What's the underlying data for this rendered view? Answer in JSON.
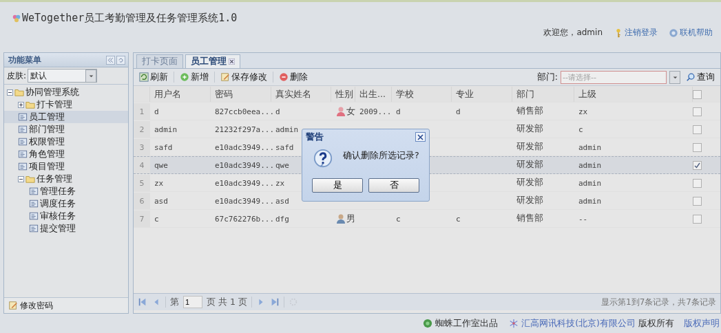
{
  "header": {
    "title": "WeTogether员工考勤管理及任务管理系统1.0",
    "welcome": "欢迎您，admin",
    "links": [
      "注销登录",
      "联机帮助"
    ]
  },
  "sidebar": {
    "title": "功能菜单",
    "skin_label": "皮肤:",
    "skin_value": "默认",
    "tree": [
      {
        "label": "协同管理系统",
        "kind": "folder",
        "expanded": true,
        "selected": false,
        "children": [
          {
            "label": "打卡管理",
            "kind": "folder",
            "expanded": false,
            "selected": false
          },
          {
            "label": "员工管理",
            "kind": "page",
            "selected": true
          },
          {
            "label": "部门管理",
            "kind": "page",
            "selected": false
          },
          {
            "label": "权限管理",
            "kind": "page",
            "selected": false
          },
          {
            "label": "角色管理",
            "kind": "page",
            "selected": false
          },
          {
            "label": "项目管理",
            "kind": "page",
            "selected": false
          },
          {
            "label": "任务管理",
            "kind": "folder",
            "expanded": true,
            "selected": false,
            "children": [
              {
                "label": "管理任务",
                "kind": "page",
                "selected": false
              },
              {
                "label": "调度任务",
                "kind": "page",
                "selected": false
              },
              {
                "label": "审核任务",
                "kind": "page",
                "selected": false
              },
              {
                "label": "提交管理",
                "kind": "page",
                "selected": false
              }
            ]
          }
        ]
      }
    ],
    "footer_link": "修改密码"
  },
  "tabs": [
    {
      "label": "打卡页面",
      "selected": false,
      "closable": false
    },
    {
      "label": "员工管理",
      "selected": true,
      "closable": true
    }
  ],
  "toolbar": {
    "buttons": [
      {
        "label": "刷新",
        "kind": "refresh"
      },
      {
        "label": "新增",
        "kind": "add"
      },
      {
        "label": "保存修改",
        "kind": "save"
      },
      {
        "label": "删除",
        "kind": "delete"
      }
    ],
    "dept_label": "部门:",
    "dept_placeholder": "--请选择--",
    "search": "查询"
  },
  "table": {
    "columns": [
      "用户名",
      "密码",
      "真实姓名",
      "性别",
      "出生...",
      "学校",
      "专业",
      "部门",
      "上级"
    ],
    "rows": [
      {
        "index": "1",
        "cells": [
          "d",
          "827ccb0eea...",
          "d",
          "女",
          "2009...",
          "d",
          "d",
          "销售部",
          "zx"
        ],
        "kind": "female",
        "selected": false,
        "checked": false
      },
      {
        "index": "2",
        "cells": [
          "admin",
          "21232f297a...",
          "admin",
          "",
          "",
          "",
          "",
          "研发部",
          "c"
        ],
        "selected": false,
        "checked": false
      },
      {
        "index": "3",
        "cells": [
          "safd",
          "e10adc3949...",
          "safd",
          "",
          "",
          "",
          "",
          "研发部",
          "admin"
        ],
        "selected": false,
        "checked": false
      },
      {
        "index": "4",
        "cells": [
          "qwe",
          "e10adc3949...",
          "qwe",
          "",
          "",
          "",
          "",
          "研发部",
          "admin"
        ],
        "selected": true,
        "checked": true
      },
      {
        "index": "5",
        "cells": [
          "zx",
          "e10adc3949...",
          "zx",
          "",
          "",
          "",
          "",
          "研发部",
          "admin"
        ],
        "selected": false,
        "checked": false
      },
      {
        "index": "6",
        "cells": [
          "asd",
          "e10adc3949...",
          "asd",
          "",
          "",
          "",
          "",
          "研发部",
          "admin"
        ],
        "selected": false,
        "checked": false
      },
      {
        "index": "7",
        "cells": [
          "c",
          "67c762276b...",
          "dfg",
          "男",
          "",
          "c",
          "c",
          "销售部",
          "--"
        ],
        "kind": "male",
        "selected": false,
        "checked": false
      }
    ],
    "header_checked": false
  },
  "pager": {
    "before": "第",
    "page": "1",
    "after": "页 共 1 页",
    "status": "显示第1到7条记录，共7条记录"
  },
  "dialog": {
    "title": "警告",
    "message": "确认删除所选记录?",
    "buttons": [
      "是",
      "否"
    ]
  },
  "footer": {
    "studio": "蜘蛛工作室出品",
    "company": "汇高网讯科技(北京)有限公司",
    "rights": "版权所有",
    "statement": "版权声明"
  }
}
